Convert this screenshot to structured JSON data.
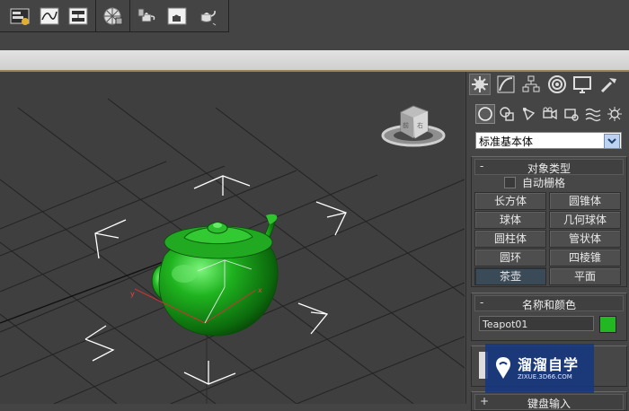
{
  "toolbar": {
    "icons": [
      "scene-explorer-icon",
      "curve-editor-icon",
      "schematic-view-icon",
      "material-editor-icon",
      "render-setup-icon",
      "rendered-frame-window-icon",
      "render-teapot-icon"
    ]
  },
  "command_panel": {
    "tabs": [
      "create-tab",
      "modify-tab",
      "hierarchy-tab",
      "motion-tab",
      "display-tab",
      "utilities-tab"
    ],
    "categories": [
      "geometry",
      "shapes",
      "lights",
      "cameras",
      "helpers",
      "space-warps",
      "systems"
    ],
    "dropdown_value": "标准基本体"
  },
  "object_type": {
    "title": "对象类型",
    "collapse_symbol": "-",
    "autogrid_label": "自动栅格",
    "buttons": [
      "长方体",
      "圆锥体",
      "球体",
      "几何球体",
      "圆柱体",
      "管状体",
      "圆环",
      "四棱锥",
      "茶壶",
      "平面"
    ],
    "active_button": "茶壶"
  },
  "name_color": {
    "title": "名称和颜色",
    "collapse_symbol": "-",
    "name_value": "Teapot01",
    "color": "#22b822"
  },
  "keyboard_entry": {
    "title": "键盘输入",
    "collapse_symbol": "+"
  },
  "watermark": {
    "text": "溜溜自学",
    "subtext": "ZIXUE.3D66.COM"
  },
  "colors": {
    "accent_active_button": "#3b4a57",
    "teapot": "#1a9a1a",
    "viewport_bg": "#3f3f3f"
  }
}
